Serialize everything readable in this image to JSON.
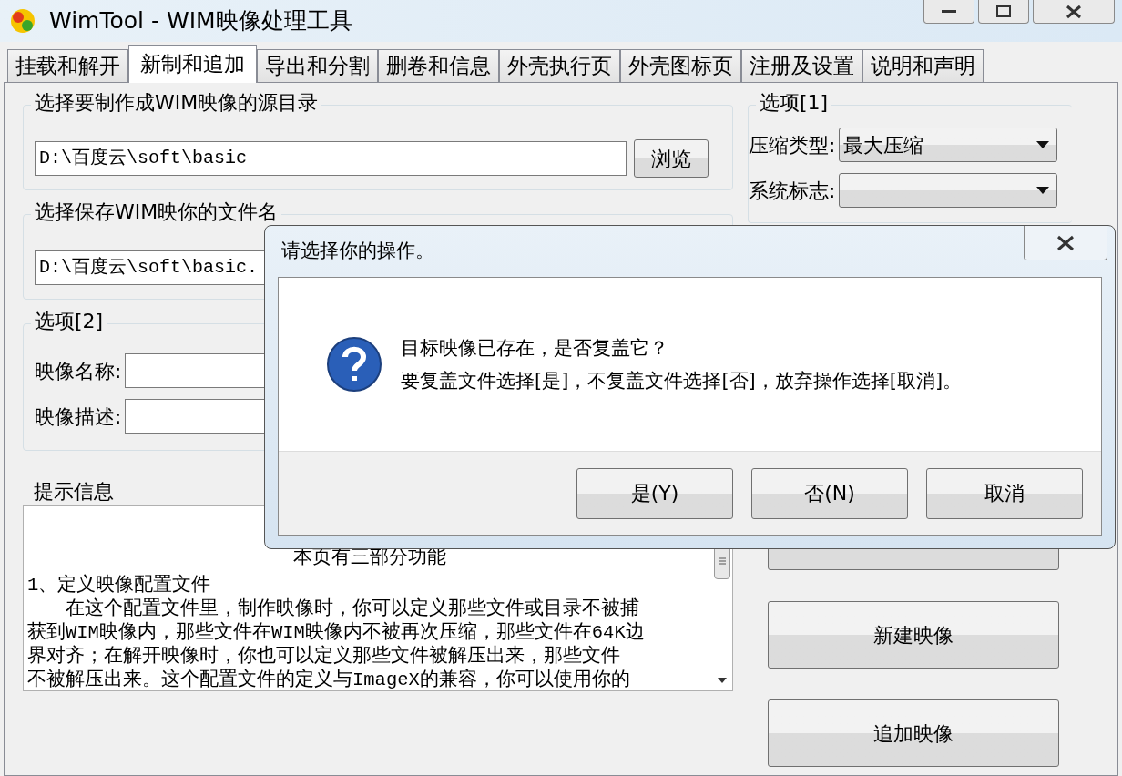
{
  "window": {
    "title": "WimTool - WIM映像处理工具"
  },
  "tabs": [
    {
      "label": "挂载和解开",
      "selected": false
    },
    {
      "label": "新制和追加",
      "selected": true
    },
    {
      "label": "导出和分割",
      "selected": false
    },
    {
      "label": "删卷和信息",
      "selected": false
    },
    {
      "label": "外壳执行页",
      "selected": false
    },
    {
      "label": "外壳图标页",
      "selected": false
    },
    {
      "label": "注册及设置",
      "selected": false
    },
    {
      "label": "说明和声明",
      "selected": false
    }
  ],
  "source_group": {
    "title": "选择要制作成WIM映像的源目录",
    "path": "D:\\百度云\\soft\\basic",
    "browse_button": "浏览"
  },
  "save_group": {
    "title": "选择保存WIM映你的文件名",
    "path": "D:\\百度云\\soft\\basic."
  },
  "options_2": {
    "title": "选项[2]",
    "fields": [
      {
        "label": "映像名称:"
      },
      {
        "label": "映像描述:"
      }
    ]
  },
  "hint": {
    "title": "提示信息",
    "heading": "本页有三部分功能",
    "lines": [
      "1、定义映像配置文件",
      "　　在这个配置文件里，制作映像时，你可以定义那些文件或目录不被捕",
      "获到WIM映像内，那些文件在WIM映像内不被再次压缩，那些文件在64K边",
      "界对齐；在解开映像时，你也可以定义那些文件被解压出来，那些文件",
      "不被解压出来。这个配置文件的定义与ImageX的兼容，你可以使用你的"
    ]
  },
  "options_1": {
    "title": "选项[1]",
    "dropdowns": [
      {
        "label": "压缩类型:",
        "value": "最大压缩"
      },
      {
        "label": "系统标志:"
      }
    ]
  },
  "action_buttons": [
    {
      "label": "新建映像"
    },
    {
      "label": "追加映像"
    }
  ],
  "dialog": {
    "title": "请选择你的操作。",
    "message": [
      "目标映像已存在，是否复盖它？",
      "要复盖文件选择[是]，不复盖文件选择[否]，放弃操作选择[取消]。"
    ],
    "buttons": [
      "是(Y)",
      "否(N)",
      "取消"
    ]
  }
}
